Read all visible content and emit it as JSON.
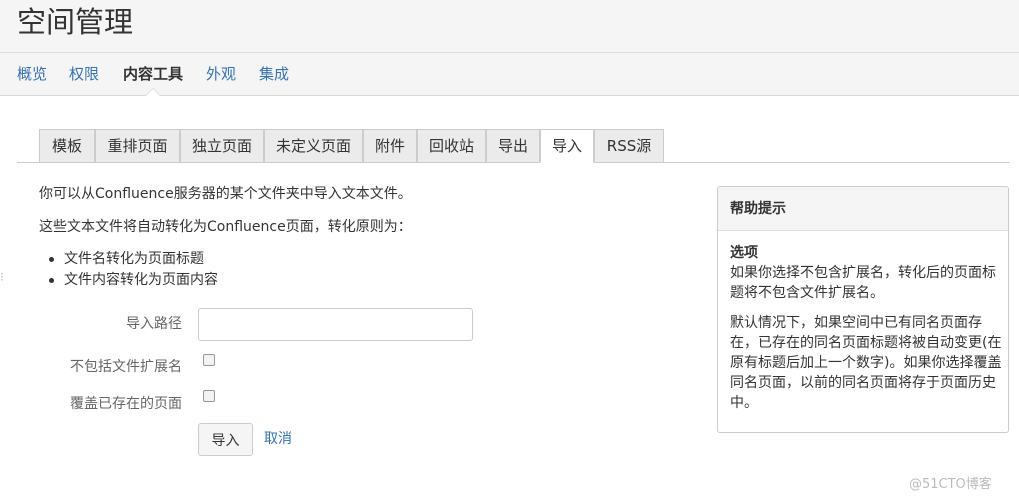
{
  "page": {
    "title": "空间管理"
  },
  "nav": {
    "items": [
      {
        "label": "概览",
        "active": false
      },
      {
        "label": "权限",
        "active": false
      },
      {
        "label": "内容工具",
        "active": true
      },
      {
        "label": "外观",
        "active": false
      },
      {
        "label": "集成",
        "active": false
      }
    ]
  },
  "tabs": {
    "items": [
      {
        "label": "模板",
        "active": false
      },
      {
        "label": "重排页面",
        "active": false
      },
      {
        "label": "独立页面",
        "active": false
      },
      {
        "label": "未定义页面",
        "active": false
      },
      {
        "label": "附件",
        "active": false
      },
      {
        "label": "回收站",
        "active": false
      },
      {
        "label": "导出",
        "active": false
      },
      {
        "label": "导入",
        "active": true
      },
      {
        "label": "RSS源",
        "active": false
      }
    ]
  },
  "content": {
    "intro1": "你可以从Confluence服务器的某个文件夹中导入文本文件。",
    "intro2": "这些文本文件将自动转化为Confluence页面，转化原则为：",
    "rules": [
      "文件名转化为页面标题",
      "文件内容转化为页面内容"
    ]
  },
  "form": {
    "path_label": "导入路径",
    "path_value": "",
    "exclude_ext_label": "不包括文件扩展名",
    "exclude_ext_checked": false,
    "overwrite_label": "覆盖已存在的页面",
    "overwrite_checked": false,
    "import_button": "导入",
    "cancel_link": "取消"
  },
  "help": {
    "title": "帮助提示",
    "subtitle": "选项",
    "para1": "如果你选择不包含扩展名，转化后的页面标题将不包含文件扩展名。",
    "para2": "默认情况下，如果空间中已有同名页面存在，已存在的同名页面标题将被自动变更(在原有标题后加上一个数字)。如果你选择覆盖同名页面，以前的同名页面将存于页面历史中。"
  },
  "watermark": "@51CTO博客",
  "colors": {
    "link": "#3572b0",
    "text": "#333333",
    "header_bg": "#f5f5f5",
    "tab_bg": "#ebebeb"
  }
}
